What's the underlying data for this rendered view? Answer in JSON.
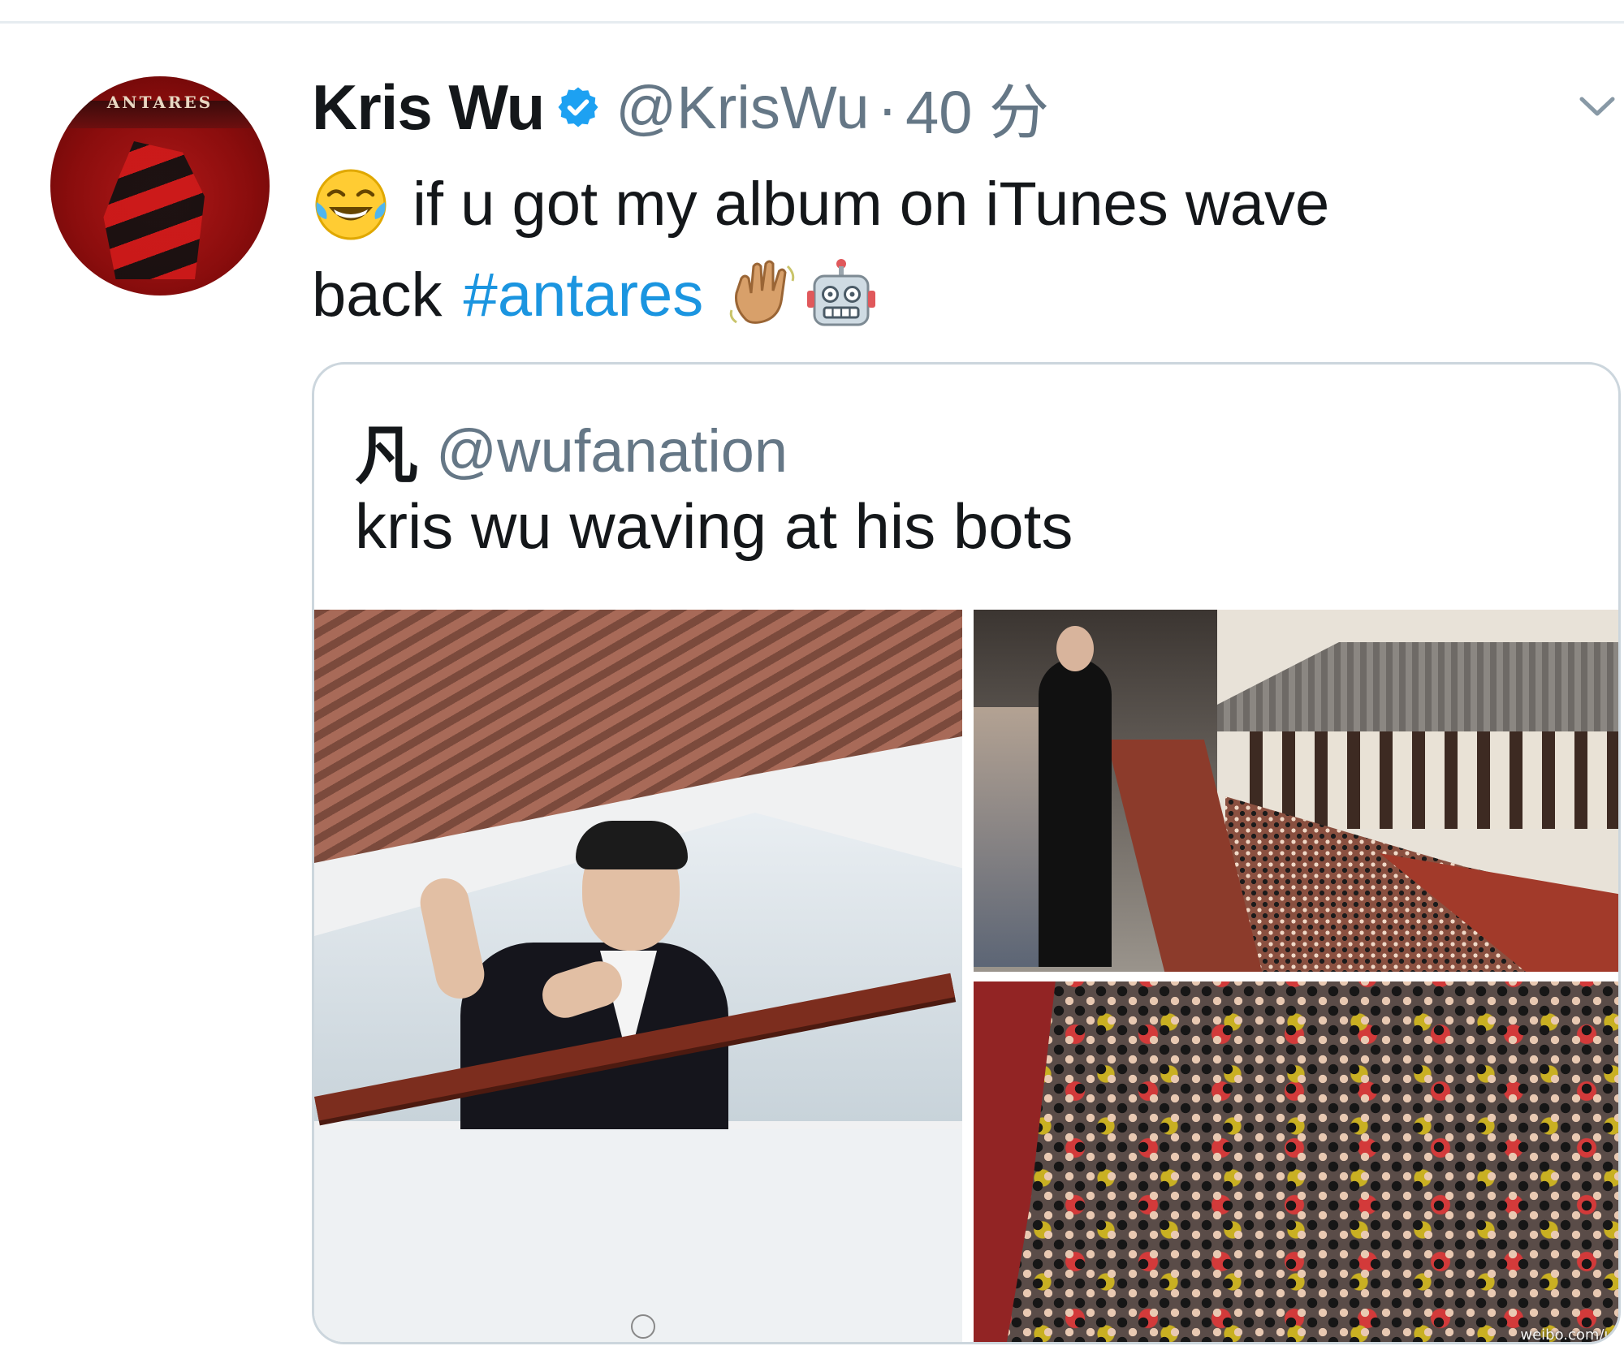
{
  "tweet": {
    "author": {
      "display_name": "Kris Wu",
      "handle": "@KrisWu",
      "separator": "·",
      "time": "40 分",
      "avatar_text": "ANTARES",
      "verified": true
    },
    "text": {
      "lead_emoji": "face-with-tears-of-joy-emoji",
      "line1": "if u got my album on iTunes wave",
      "line2_word": "back",
      "hashtag": "#antares",
      "trailing_emojis": [
        "waving-hand-emoji",
        "robot-emoji"
      ]
    },
    "menu_icon": "chevron-down-icon",
    "quoted": {
      "name": "凡",
      "handle": "@wufanation",
      "text": "kris wu waving at his bots",
      "media": [
        {
          "name": "photo-man-waving-on-balcony"
        },
        {
          "name": "photo-man-on-balcony-above-crowd"
        },
        {
          "name": "photo-crowd-top-view",
          "watermark": "weibo.com/u/"
        }
      ]
    }
  },
  "colors": {
    "text": "#14171a",
    "muted": "#657786",
    "link": "#1b95e0",
    "verified": "#1da1f2",
    "border": "#ccd6dd"
  }
}
